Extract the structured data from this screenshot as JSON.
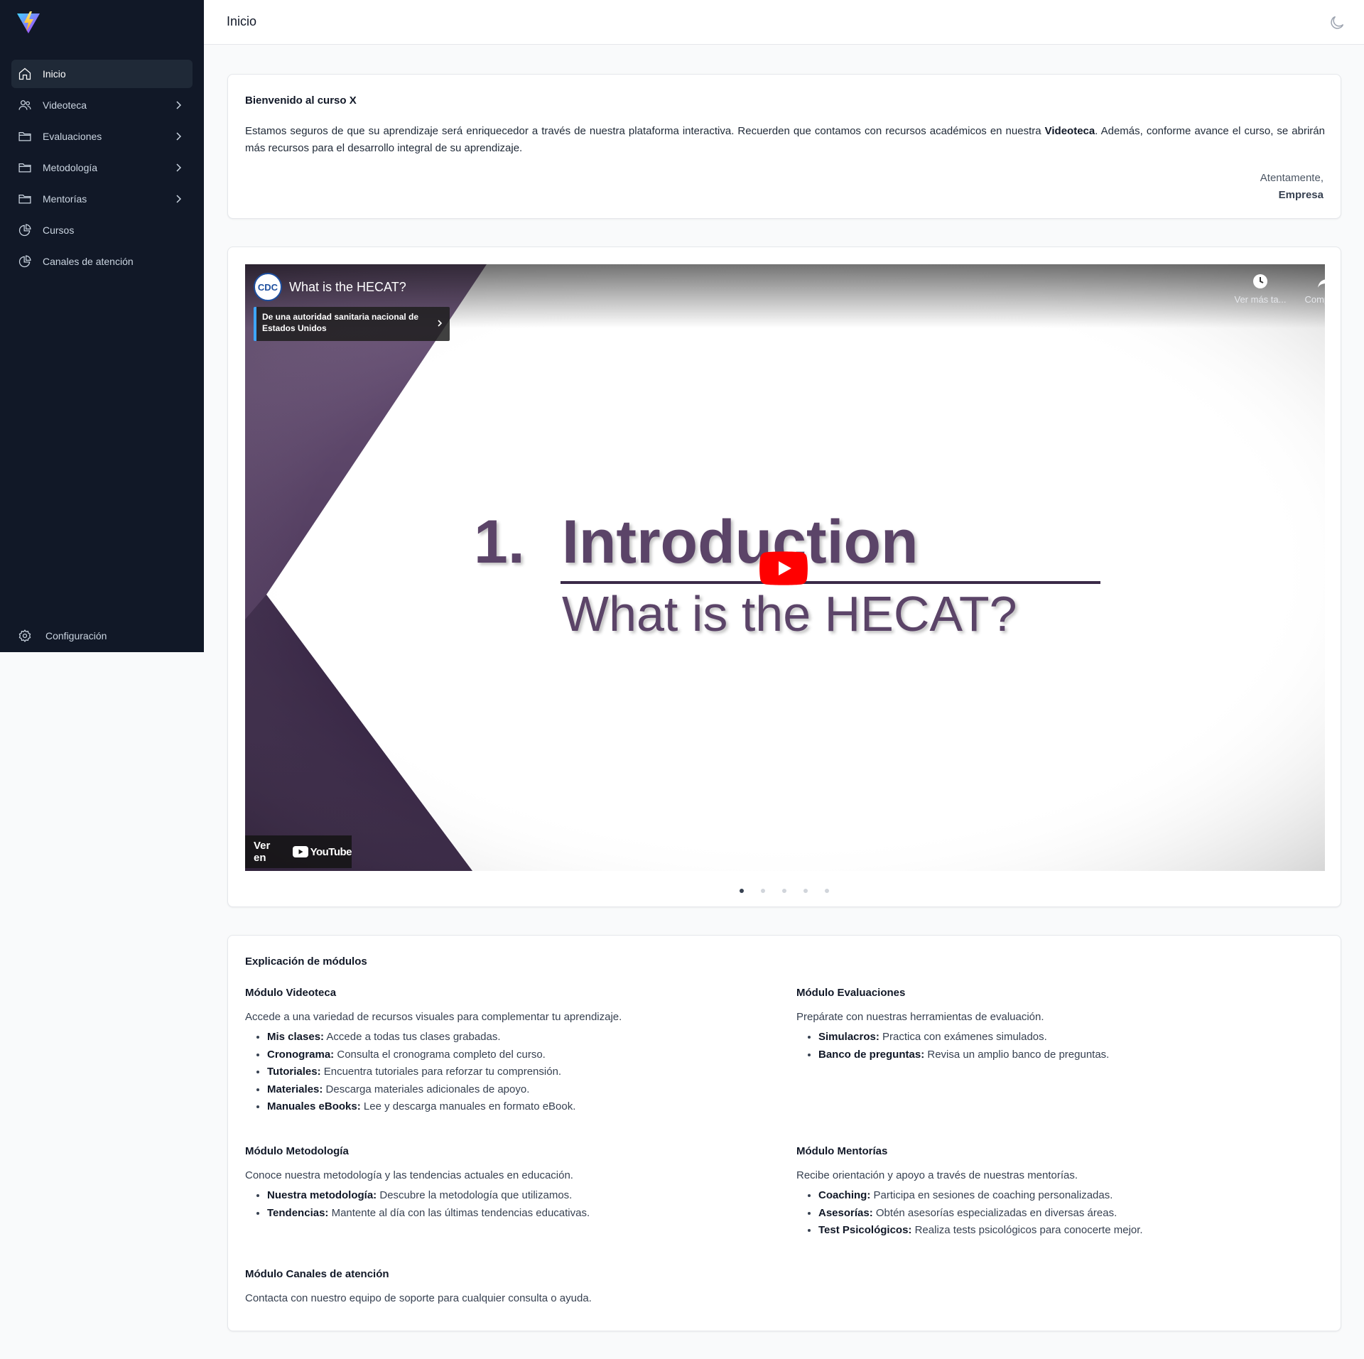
{
  "sidebar": {
    "items": [
      {
        "label": "Inicio",
        "icon": "home-icon",
        "active": true,
        "has_submenu": false
      },
      {
        "label": "Videoteca",
        "icon": "users-icon",
        "active": false,
        "has_submenu": true
      },
      {
        "label": "Evaluaciones",
        "icon": "folder-icon",
        "active": false,
        "has_submenu": true
      },
      {
        "label": "Metodología",
        "icon": "folder-icon",
        "active": false,
        "has_submenu": true
      },
      {
        "label": "Mentorías",
        "icon": "folder-icon",
        "active": false,
        "has_submenu": true
      },
      {
        "label": "Cursos",
        "icon": "pie-chart-icon",
        "active": false,
        "has_submenu": false
      },
      {
        "label": "Canales de atención",
        "icon": "pie-chart-icon",
        "active": false,
        "has_submenu": false
      }
    ],
    "config_label": "Configuración"
  },
  "header": {
    "title": "Inicio"
  },
  "welcome": {
    "title": "Bienvenido al curso X",
    "text_before": "Estamos seguros de que su aprendizaje será enriquecedor a través de nuestra plataforma interactiva. Recuerden que contamos con recursos académicos en nuestra ",
    "text_bold": "Videoteca",
    "text_after": ". Además, conforme avance el curso, se abrirán más recursos para el desarrollo integral de su aprendizaje.",
    "closing": "Atentamente,",
    "company": "Empresa"
  },
  "video": {
    "channel_badge": "CDC",
    "title": "What is the HECAT?",
    "info_panel": "De una autoridad sanitaria nacional de Estados Unidos",
    "watch_later_label": "Ver más ta...",
    "share_label": "Compartir",
    "slide_number": "1.",
    "slide_title": "Introduction",
    "slide_subtitle": "What is the HECAT?",
    "watch_on_label": "Ver en",
    "youtube_word": "YouTube",
    "carousel_count": 5,
    "carousel_active": 0
  },
  "modules": {
    "title": "Explicación de módulos",
    "videoteca": {
      "title": "Módulo Videoteca",
      "desc": "Accede a una variedad de recursos visuales para complementar tu aprendizaje.",
      "items": [
        {
          "term": "Mis clases:",
          "text": " Accede a todas tus clases grabadas."
        },
        {
          "term": "Cronograma:",
          "text": " Consulta el cronograma completo del curso."
        },
        {
          "term": "Tutoriales:",
          "text": " Encuentra tutoriales para reforzar tu comprensión."
        },
        {
          "term": "Materiales:",
          "text": " Descarga materiales adicionales de apoyo."
        },
        {
          "term": "Manuales eBooks:",
          "text": " Lee y descarga manuales en formato eBook."
        }
      ]
    },
    "evaluaciones": {
      "title": "Módulo Evaluaciones",
      "desc": "Prepárate con nuestras herramientas de evaluación.",
      "items": [
        {
          "term": "Simulacros:",
          "text": " Practica con exámenes simulados."
        },
        {
          "term": "Banco de preguntas:",
          "text": " Revisa un amplio banco de preguntas."
        }
      ]
    },
    "metodologia": {
      "title": "Módulo Metodología",
      "desc": "Conoce nuestra metodología y las tendencias actuales en educación.",
      "items": [
        {
          "term": "Nuestra metodología:",
          "text": " Descubre la metodología que utilizamos."
        },
        {
          "term": "Tendencias:",
          "text": " Mantente al día con las últimas tendencias educativas."
        }
      ]
    },
    "mentorias": {
      "title": "Módulo Mentorías",
      "desc": "Recibe orientación y apoyo a través de nuestras mentorías.",
      "items": [
        {
          "term": "Coaching:",
          "text": " Participa en sesiones de coaching personalizadas."
        },
        {
          "term": "Asesorías:",
          "text": " Obtén asesorías especializadas en diversas áreas."
        },
        {
          "term": "Test Psicológicos:",
          "text": " Realiza tests psicológicos para conocerte mejor."
        }
      ]
    },
    "canales": {
      "title": "Módulo Canales de atención",
      "desc": "Contacta con nuestro equipo de soporte para cualquier consulta o ayuda."
    }
  },
  "colors": {
    "sidebar_bg": "#111827",
    "sidebar_active_bg": "#1f2937",
    "page_bg": "#f9fafb",
    "slide_purple": "#5b4468",
    "youtube_red": "#ff0000"
  }
}
